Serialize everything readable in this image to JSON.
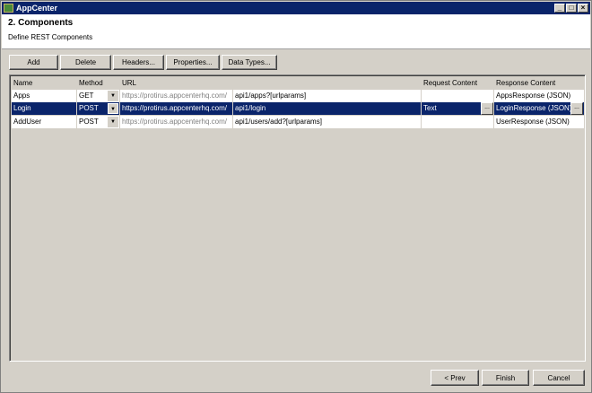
{
  "window": {
    "title": "AppCenter",
    "controls": [
      "_",
      "□",
      "×"
    ]
  },
  "header": {
    "title": "2. Components",
    "subtitle": "Define REST Components"
  },
  "toolbar": {
    "add": "Add",
    "delete": "Delete",
    "headers": "Headers...",
    "properties": "Properties...",
    "data_types": "Data Types..."
  },
  "grid": {
    "columns": [
      "Name",
      "Method",
      "URL",
      "Request Content",
      "Response Content"
    ],
    "rows": [
      {
        "name": "Apps",
        "method": "GET",
        "base_url": "https://protirus.appcenterhq.com/",
        "path": "api1/apps?[urlparams]",
        "request": "",
        "response": "AppsResponse (JSON)"
      },
      {
        "name": "Login",
        "method": "POST",
        "base_url": "https://protirus.appcenterhq.com/",
        "path": "api1/login",
        "request": "Text",
        "response": "LoginResponse (JSON)"
      },
      {
        "name": "AddUser",
        "method": "POST",
        "base_url": "https://protirus.appcenterhq.com/",
        "path": "api1/users/add?[urlparams]",
        "request": "",
        "response": "UserResponse (JSON)"
      }
    ],
    "ellipsis": "..."
  },
  "footer": {
    "prev": "< Prev",
    "finish": "Finish",
    "cancel": "Cancel"
  }
}
